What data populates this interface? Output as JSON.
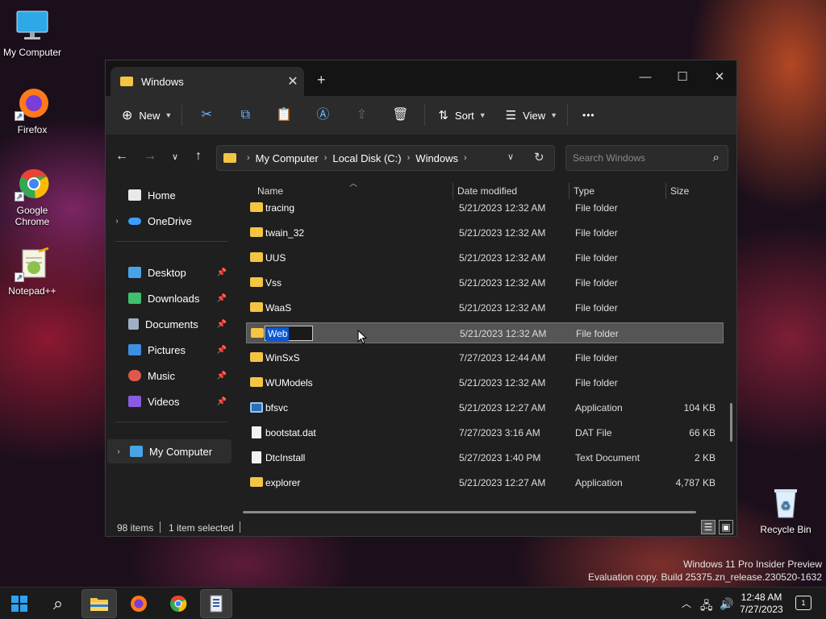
{
  "desktop": {
    "icons": [
      {
        "label": "My Computer",
        "icon": "monitor-icon"
      },
      {
        "label": "Firefox",
        "icon": "firefox-icon"
      },
      {
        "label": "Google Chrome",
        "icon": "chrome-icon"
      },
      {
        "label": "Notepad++",
        "icon": "notepadpp-icon"
      },
      {
        "label": "Recycle Bin",
        "icon": "recycle-bin-icon"
      }
    ],
    "watermark": {
      "line1": "Windows 11 Pro Insider Preview",
      "line2": "Evaluation copy. Build 25375.zn_release.230520-1632"
    }
  },
  "window": {
    "tab_title": "Windows",
    "tab_close": "✕",
    "new_tab": "+",
    "controls": {
      "minimize": "—",
      "maximize": "☐",
      "close": "✕"
    },
    "toolbar": {
      "new_label": "New",
      "sort_label": "Sort",
      "view_label": "View",
      "more": "•••"
    },
    "address": {
      "crumbs": [
        "My Computer",
        "Local Disk (C:)",
        "Windows"
      ]
    },
    "search": {
      "placeholder": "Search Windows"
    },
    "sidebar": [
      {
        "label": "Home",
        "icon": "home-icon",
        "color": "#e9e9e9"
      },
      {
        "label": "OneDrive",
        "icon": "onedrive-icon",
        "color": "#3aa0ff"
      },
      {
        "label": "Desktop",
        "icon": "desktop-icon",
        "color": "#4aa3e6"
      },
      {
        "label": "Downloads",
        "icon": "download-icon",
        "color": "#3fbf6f"
      },
      {
        "label": "Documents",
        "icon": "documents-icon",
        "color": "#9fb0c4"
      },
      {
        "label": "Pictures",
        "icon": "pictures-icon",
        "color": "#3d8fe0"
      },
      {
        "label": "Music",
        "icon": "music-icon",
        "color": "#e0584a"
      },
      {
        "label": "Videos",
        "icon": "videos-icon",
        "color": "#8a5be0"
      },
      {
        "label": "My Computer",
        "icon": "computer-icon",
        "color": "#4aa3e6"
      }
    ],
    "columns": {
      "name": "Name",
      "date": "Date modified",
      "type": "Type",
      "size": "Size"
    },
    "files": [
      {
        "name": "tracing",
        "date": "5/21/2023 12:32 AM",
        "type": "File folder",
        "size": "",
        "kind": "folder"
      },
      {
        "name": "twain_32",
        "date": "5/21/2023 12:32 AM",
        "type": "File folder",
        "size": "",
        "kind": "folder"
      },
      {
        "name": "UUS",
        "date": "5/21/2023 12:32 AM",
        "type": "File folder",
        "size": "",
        "kind": "folder"
      },
      {
        "name": "Vss",
        "date": "5/21/2023 12:32 AM",
        "type": "File folder",
        "size": "",
        "kind": "folder"
      },
      {
        "name": "WaaS",
        "date": "5/21/2023 12:32 AM",
        "type": "File folder",
        "size": "",
        "kind": "folder"
      },
      {
        "name": "Web",
        "date": "5/21/2023 12:32 AM",
        "type": "File folder",
        "size": "",
        "kind": "folder",
        "renaming": true
      },
      {
        "name": "WinSxS",
        "date": "7/27/2023 12:44 AM",
        "type": "File folder",
        "size": "",
        "kind": "folder"
      },
      {
        "name": "WUModels",
        "date": "5/21/2023 12:32 AM",
        "type": "File folder",
        "size": "",
        "kind": "folder"
      },
      {
        "name": "bfsvc",
        "date": "5/21/2023 12:27 AM",
        "type": "Application",
        "size": "104 KB",
        "kind": "app"
      },
      {
        "name": "bootstat.dat",
        "date": "7/27/2023 3:16 AM",
        "type": "DAT File",
        "size": "66 KB",
        "kind": "file"
      },
      {
        "name": "DtcInstall",
        "date": "5/27/2023 1:40 PM",
        "type": "Text Document",
        "size": "2 KB",
        "kind": "file"
      },
      {
        "name": "explorer",
        "date": "5/21/2023 12:27 AM",
        "type": "Application",
        "size": "4,787 KB",
        "kind": "folder"
      }
    ],
    "status": {
      "items": "98 items",
      "selected": "1 item selected"
    }
  },
  "taskbar": {
    "clock_time": "12:48 AM",
    "clock_date": "7/27/2023",
    "notifications": "1",
    "chevron": "︿"
  }
}
